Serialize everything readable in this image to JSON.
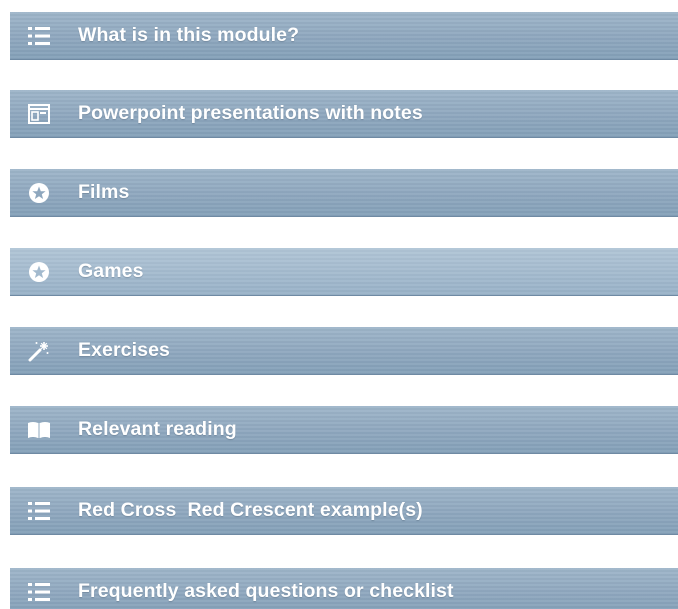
{
  "menu": {
    "items": [
      {
        "label": "What is in this module?",
        "icon": "list-icon"
      },
      {
        "label": "Powerpoint presentations with notes",
        "icon": "presentation-icon"
      },
      {
        "label": "Films",
        "icon": "star-circle-icon"
      },
      {
        "label": "Games",
        "icon": "star-circle-icon"
      },
      {
        "label": "Exercises",
        "icon": "magic-wand-icon"
      },
      {
        "label": "Relevant reading",
        "icon": "open-book-icon"
      },
      {
        "label": "Red Cross  Red Crescent example(s)",
        "icon": "list-icon"
      },
      {
        "label": "Frequently asked questions or checklist",
        "icon": "list-icon"
      }
    ]
  },
  "colors": {
    "bar": "#8ea7be",
    "bar_hover": "#a3bace",
    "text": "#ffffff"
  }
}
